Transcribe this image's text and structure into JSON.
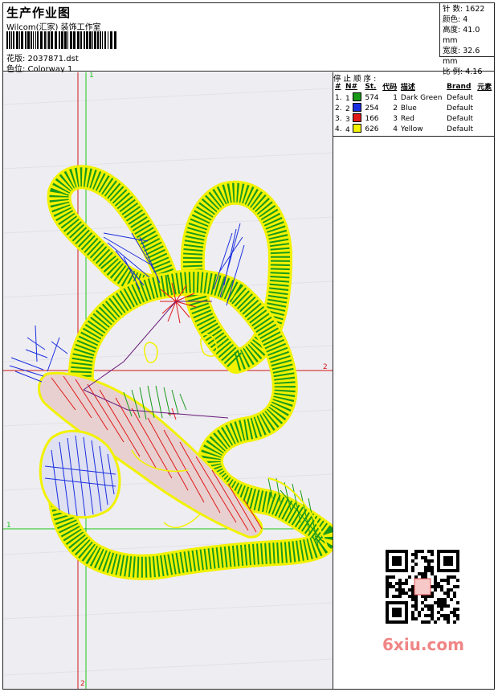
{
  "header": {
    "title": "生产作业图",
    "company": "Wilcom(汇家) 装饰工作室",
    "design_line": "花版: 2037871.dst",
    "colorway_line": "色位: Colorway 1"
  },
  "stats": {
    "stitches": "针 数: 1622",
    "colors": "颜色: 4",
    "height": "高度: 41.0 mm",
    "width": "宽度: 32.6 mm",
    "ratio": "比 例: 4.16"
  },
  "colorlist": {
    "title": "停 止 顺 序 :",
    "headers": [
      "#",
      "N#",
      "St.",
      "代码",
      "描述",
      "Brand",
      "元素"
    ],
    "rows": [
      {
        "idx": "1.",
        "n": "1",
        "color": "#1a9a1a",
        "st": "574",
        "code": "1",
        "desc": "Dark Green",
        "brand": "Default"
      },
      {
        "idx": "2.",
        "n": "2",
        "color": "#1a2fe0",
        "st": "254",
        "code": "2",
        "desc": "Blue",
        "brand": "Default"
      },
      {
        "idx": "3.",
        "n": "3",
        "color": "#e01a1a",
        "st": "166",
        "code": "3",
        "desc": "Red",
        "brand": "Default"
      },
      {
        "idx": "4.",
        "n": "4",
        "color": "#f4f400",
        "st": "626",
        "code": "4",
        "desc": "Yellow",
        "brand": "Default"
      }
    ]
  },
  "axes": {
    "label_1": "1",
    "label_2": "2"
  },
  "watermark": "6xiu.com"
}
